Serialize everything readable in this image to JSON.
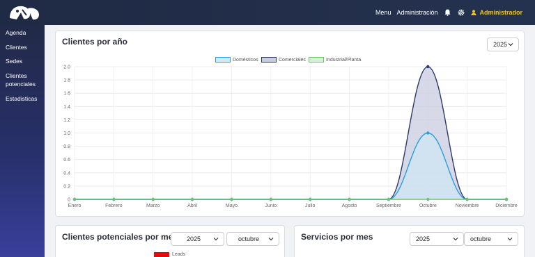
{
  "topbar": {
    "menu_label": "Menu",
    "admin_link": "Administración",
    "user_label": "Administrador",
    "icons": [
      "logo-icon",
      "bell-icon",
      "gear-icon",
      "user-icon"
    ],
    "user_color": "#f0c419"
  },
  "sidebar": {
    "items": [
      {
        "label": "Agenda"
      },
      {
        "label": "Clientes"
      },
      {
        "label": "Sedes"
      },
      {
        "label": "Clientes potenciales"
      },
      {
        "label": "Estadisticas"
      }
    ]
  },
  "clientes_card": {
    "title": "Clientes por año",
    "year_select": "2025"
  },
  "leads_card": {
    "title": "Clientes potenciales por mes",
    "year_select": "2025",
    "month_select": "octubre",
    "legend_label": "Leads",
    "legend_color": "#e30b0b"
  },
  "servicios_card": {
    "title": "Servicios por mes",
    "year_select": "2025",
    "month_select": "octubre"
  },
  "chart_data": {
    "type": "area",
    "title": "",
    "categories": [
      "Enero",
      "Febrero",
      "Marzo",
      "Abril",
      "Mayo",
      "Junio",
      "Julio",
      "Agosto",
      "Septiembre",
      "Octubre",
      "Noviembre",
      "Diciembre"
    ],
    "series": [
      {
        "name": "Domésticos",
        "values": [
          0,
          0,
          0,
          0,
          0,
          0,
          0,
          0,
          0,
          1,
          0,
          0
        ],
        "color": "#2a9fd8",
        "fill": "#cde9f7"
      },
      {
        "name": "Comerciales",
        "values": [
          0,
          0,
          0,
          0,
          0,
          0,
          0,
          0,
          0,
          2,
          0,
          0
        ],
        "color": "#2b3a67",
        "fill": "#c9cce0"
      },
      {
        "name": "Industrial/Planta",
        "values": [
          0,
          0,
          0,
          0,
          0,
          0,
          0,
          0,
          0,
          0,
          0,
          0
        ],
        "color": "#6cc46c",
        "fill": "#d6efd6"
      }
    ],
    "yticks": [
      "0",
      "0.2",
      "0.4",
      "0.6",
      "0.8",
      "1.0",
      "1.2",
      "1.4",
      "1.6",
      "1.8",
      "2.0"
    ],
    "ylim": [
      0,
      2
    ],
    "grid": true,
    "legend_position": "top"
  }
}
